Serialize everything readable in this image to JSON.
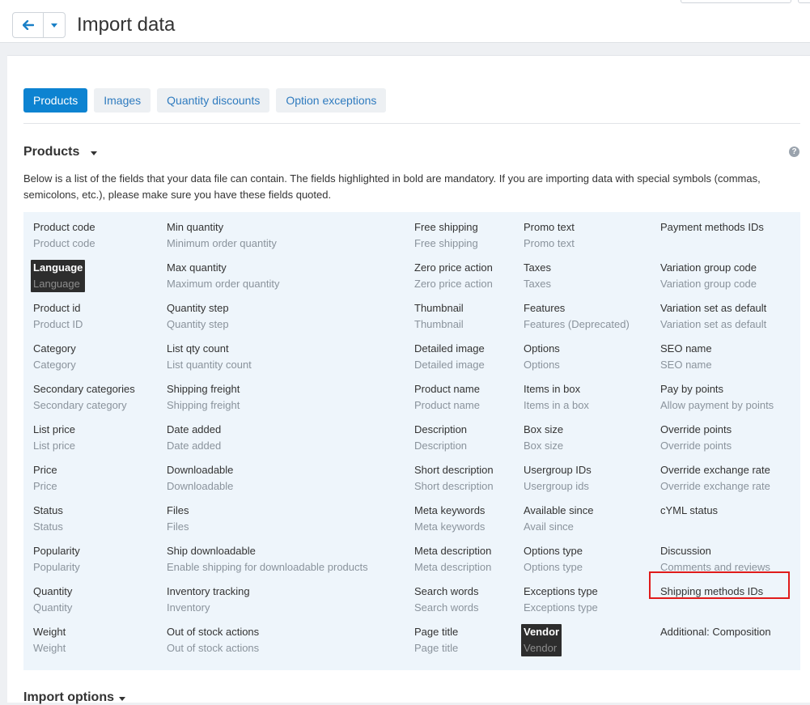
{
  "header": {
    "title": "Import data"
  },
  "tabs": [
    {
      "label": "Products",
      "active": true
    },
    {
      "label": "Images",
      "active": false
    },
    {
      "label": "Quantity discounts",
      "active": false
    },
    {
      "label": "Option exceptions",
      "active": false
    }
  ],
  "section": {
    "title": "Products",
    "description": "Below is a list of the fields that your data file can contain. The fields highlighted in bold are mandatory. If you are importing data with special symbols (commas, semicolons, etc.), please make sure you have these fields quoted."
  },
  "columns": [
    [
      {
        "name": "Product code",
        "desc": "Product code"
      },
      {
        "name": "Language",
        "desc": "Language",
        "mandatory": true
      },
      {
        "name": "Product id",
        "desc": "Product ID"
      },
      {
        "name": "Category",
        "desc": "Category"
      },
      {
        "name": "Secondary categories",
        "desc": "Secondary category"
      },
      {
        "name": "List price",
        "desc": "List price"
      },
      {
        "name": "Price",
        "desc": "Price"
      },
      {
        "name": "Status",
        "desc": "Status"
      },
      {
        "name": "Popularity",
        "desc": "Popularity"
      },
      {
        "name": "Quantity",
        "desc": "Quantity"
      },
      {
        "name": "Weight",
        "desc": "Weight"
      }
    ],
    [
      {
        "name": "Min quantity",
        "desc": "Minimum order quantity"
      },
      {
        "name": "Max quantity",
        "desc": "Maximum order quantity"
      },
      {
        "name": "Quantity step",
        "desc": "Quantity step"
      },
      {
        "name": "List qty count",
        "desc": "List quantity count"
      },
      {
        "name": "Shipping freight",
        "desc": "Shipping freight"
      },
      {
        "name": "Date added",
        "desc": "Date added"
      },
      {
        "name": "Downloadable",
        "desc": "Downloadable"
      },
      {
        "name": "Files",
        "desc": "Files"
      },
      {
        "name": "Ship downloadable",
        "desc": "Enable shipping for downloadable products"
      },
      {
        "name": "Inventory tracking",
        "desc": "Inventory"
      },
      {
        "name": "Out of stock actions",
        "desc": "Out of stock actions"
      }
    ],
    [
      {
        "name": "Free shipping",
        "desc": "Free shipping"
      },
      {
        "name": "Zero price action",
        "desc": "Zero price action"
      },
      {
        "name": "Thumbnail",
        "desc": "Thumbnail"
      },
      {
        "name": "Detailed image",
        "desc": "Detailed image"
      },
      {
        "name": "Product name",
        "desc": "Product name"
      },
      {
        "name": "Description",
        "desc": "Description"
      },
      {
        "name": "Short description",
        "desc": "Short description"
      },
      {
        "name": "Meta keywords",
        "desc": "Meta keywords"
      },
      {
        "name": "Meta description",
        "desc": "Meta description"
      },
      {
        "name": "Search words",
        "desc": "Search words"
      },
      {
        "name": "Page title",
        "desc": "Page title"
      }
    ],
    [
      {
        "name": "Promo text",
        "desc": "Promo text"
      },
      {
        "name": "Taxes",
        "desc": "Taxes"
      },
      {
        "name": "Features",
        "desc": "Features (Deprecated)"
      },
      {
        "name": "Options",
        "desc": "Options"
      },
      {
        "name": "Items in box",
        "desc": "Items in a box"
      },
      {
        "name": "Box size",
        "desc": "Box size"
      },
      {
        "name": "Usergroup IDs",
        "desc": "Usergroup ids"
      },
      {
        "name": "Available since",
        "desc": "Avail since"
      },
      {
        "name": "Options type",
        "desc": "Options type"
      },
      {
        "name": "Exceptions type",
        "desc": "Exceptions type"
      },
      {
        "name": "Vendor",
        "desc": "Vendor",
        "mandatory": true
      }
    ],
    [
      {
        "name": "Payment methods IDs",
        "desc": ""
      },
      {
        "name": "Variation group code",
        "desc": "Variation group code"
      },
      {
        "name": "Variation set as default",
        "desc": "Variation set as default"
      },
      {
        "name": "SEO name",
        "desc": "SEO name"
      },
      {
        "name": "Pay by points",
        "desc": "Allow payment by points"
      },
      {
        "name": "Override points",
        "desc": "Override points"
      },
      {
        "name": "Override exchange rate",
        "desc": "Override exchange rate"
      },
      {
        "name": "cYML status",
        "desc": ""
      },
      {
        "name": "Discussion",
        "desc": "Comments and reviews"
      },
      {
        "name": "Shipping methods IDs",
        "desc": ""
      },
      {
        "name": "Additional: Composition",
        "desc": "",
        "highlighted": true
      }
    ]
  ],
  "section2": {
    "title": "Import options"
  },
  "colors": {
    "accent": "#0d83d1",
    "highlight": "#e01b1b",
    "mandatory_bg": "#2d2d2d"
  }
}
